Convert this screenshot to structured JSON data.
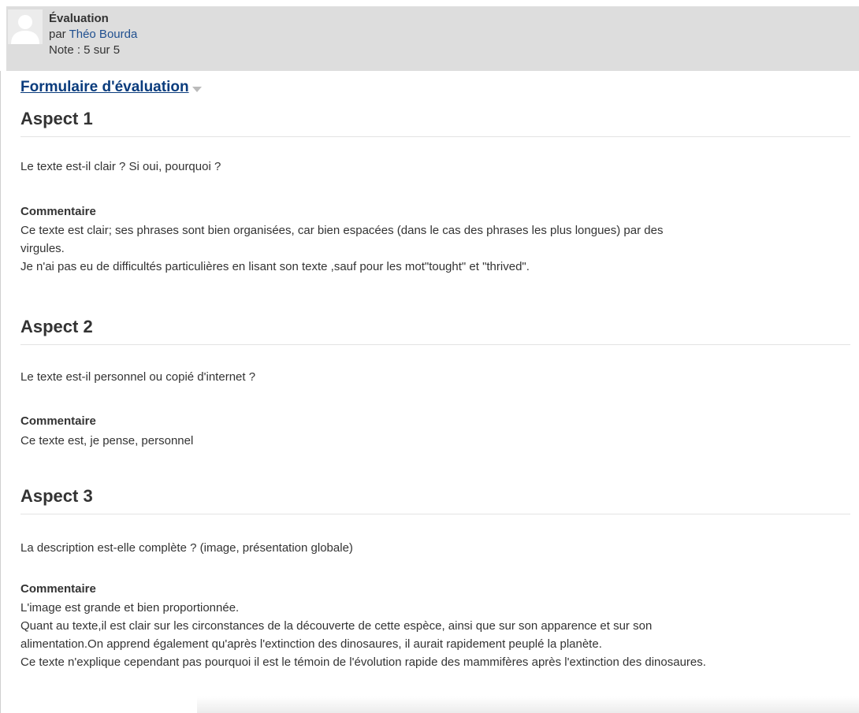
{
  "header": {
    "title": "Évaluation",
    "author_prefix": "par ",
    "author_name": "Théo Bourda",
    "grade": "Note : 5 sur 5",
    "avatar_icon": "user-avatar-icon"
  },
  "form_link": {
    "label": "Formulaire d'évaluation ",
    "icon": "caret-down-icon"
  },
  "aspects": [
    {
      "title": "Aspect 1",
      "question": "Le texte est-il clair ? Si oui, pourquoi ?",
      "comment_label": "Commentaire",
      "comment_lines": [
        "Ce texte est clair; ses phrases sont bien organisées, car bien espacées (dans le cas des phrases les plus longues) par des",
        "virgules.",
        "Je n'ai pas eu de difficultés particulières en lisant son texte ,sauf pour les mot\"tought\" et \"thrived\"."
      ]
    },
    {
      "title": "Aspect 2",
      "question": "Le texte est-il personnel ou copié d'internet ?",
      "comment_label": "Commentaire",
      "comment_lines": [
        "Ce texte est, je pense, personnel"
      ]
    },
    {
      "title": "Aspect 3",
      "question": "La description est-elle complète ? (image, présentation globale)",
      "comment_label": "Commentaire",
      "comment_lines": [
        "L'image est grande et bien proportionnée.",
        "Quant au texte,il est clair sur les circonstances de la découverte de cette espèce, ainsi que sur son apparence et sur son",
        "alimentation.On apprend également qu'après l'extinction des dinosaures, il aurait rapidement peuplé la planète.",
        "Ce texte n'explique cependant pas pourquoi il est le témoin de l'évolution rapide des mammifères après l'extinction des dinosaures."
      ]
    }
  ]
}
